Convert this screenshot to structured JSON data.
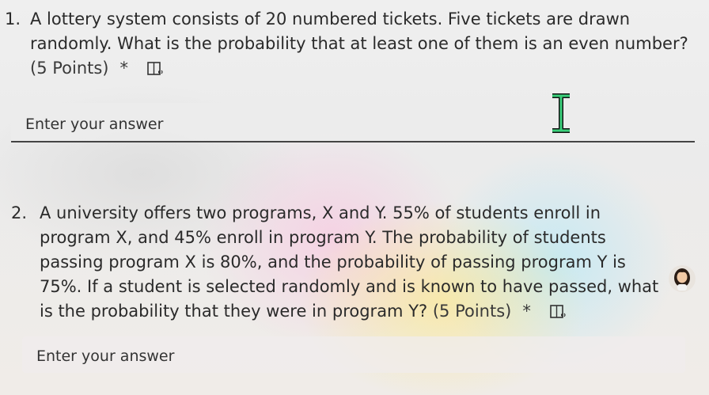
{
  "q1": {
    "number": "1.",
    "text": "A lottery system consists of 20 numbered tickets. Five tickets are drawn randomly. What is the probability that at least one of them is an even number?",
    "points": "(5 Points)",
    "required_mark": "*",
    "answer_placeholder": "Enter your answer"
  },
  "q2": {
    "number": "2.",
    "text": "A university offers two programs, X and Y. 55% of students enroll in program X, and 45% enroll in program Y. The probability of students passing program X is 80%, and the probability of passing program Y is 75%. If a student is selected randomly and is known to have passed, what is the probability that they were in program Y?",
    "points": "(5 Points)",
    "required_mark": "*",
    "answer_placeholder": "Enter your answer"
  },
  "icons": {
    "reader": "immersive-reader-icon",
    "cursor": "text-cursor-icon",
    "avatar": "avatar-icon"
  }
}
